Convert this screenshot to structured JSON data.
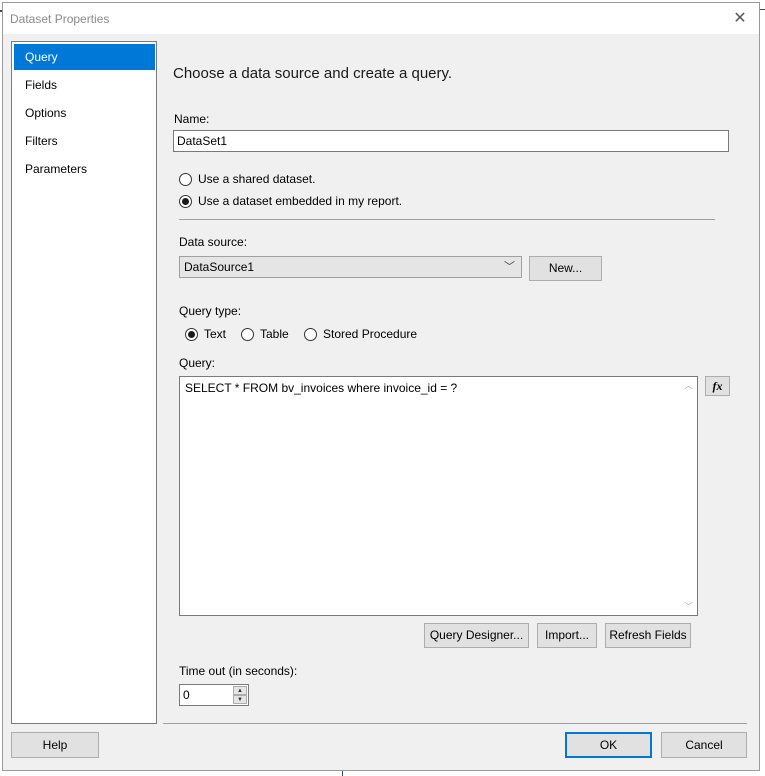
{
  "window": {
    "title": "Dataset Properties"
  },
  "nav": {
    "items": [
      {
        "label": "Query",
        "selected": true
      },
      {
        "label": "Fields",
        "selected": false
      },
      {
        "label": "Options",
        "selected": false
      },
      {
        "label": "Filters",
        "selected": false
      },
      {
        "label": "Parameters",
        "selected": false
      }
    ]
  },
  "main": {
    "heading": "Choose a data source and create a query.",
    "name_label": "Name:",
    "name_value": "DataSet1",
    "dataset_options": [
      {
        "label": "Use a shared dataset.",
        "selected": false
      },
      {
        "label": "Use a dataset embedded in my report.",
        "selected": true
      }
    ],
    "data_source_label": "Data source:",
    "data_source_value": "DataSource1",
    "new_button": "New...",
    "query_type_label": "Query type:",
    "query_types": [
      {
        "label": "Text",
        "selected": true
      },
      {
        "label": "Table",
        "selected": false
      },
      {
        "label": "Stored Procedure",
        "selected": false
      }
    ],
    "query_label": "Query:",
    "query_text": "SELECT * FROM bv_invoices where invoice_id = ?",
    "fx_button": "fx",
    "query_designer_button": "Query Designer...",
    "import_button": "Import...",
    "refresh_fields_button": "Refresh Fields",
    "timeout_label": "Time out (in seconds):",
    "timeout_value": "0"
  },
  "footer": {
    "help_button": "Help",
    "ok_button": "OK",
    "cancel_button": "Cancel"
  },
  "colors": {
    "accent": "#0078d7",
    "dialog_bg": "#f0f0f0",
    "button_bg": "#e1e1e1"
  },
  "icons": {
    "close": "close-icon",
    "dropdown": "chevron-down-icon",
    "expression": "expression-fx-icon"
  }
}
